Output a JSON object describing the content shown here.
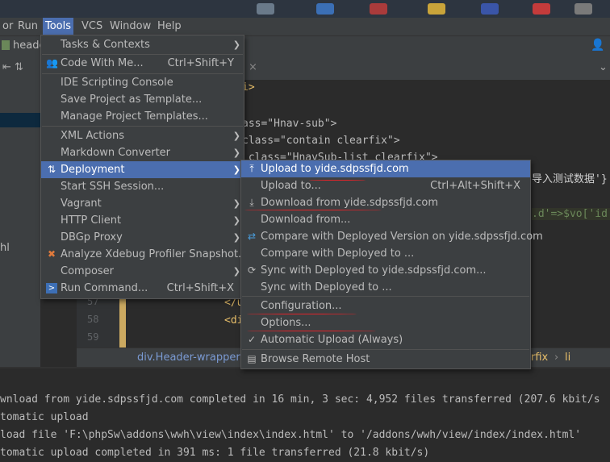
{
  "menubar": {
    "items": [
      {
        "label": "or"
      },
      {
        "label": "Run"
      },
      {
        "label": "Tools"
      },
      {
        "label": "VCS"
      },
      {
        "label": "Window"
      },
      {
        "label": "Help"
      }
    ]
  },
  "toolbar": {
    "tab_label": "heade",
    "close_icon": "×"
  },
  "editor": {
    "lines": [
      {
        "text": "i>"
      },
      {
        "text": "ass=\"Hnav-sub\">"
      },
      {
        "text": "class=\"contain clearfix\">"
      },
      {
        "text": " class=\"HnavSub-list clearfix\">"
      },
      {
        "text": "导入测试数据'}"
      },
      {
        "text": ".d'=>$vo['id'"
      }
    ],
    "line_numbers": [
      "57",
      "58",
      "59"
    ],
    "bottom_code": [
      {
        "text": "</u"
      },
      {
        "text": "<di"
      }
    ]
  },
  "breadcrumb": {
    "left": "div.Header-wrapper",
    "right_a": "rfix",
    "right_sep": "›",
    "right_b": "li"
  },
  "sidebar": {
    "label": "hl"
  },
  "console": {
    "lines": [
      "wnload from yide.sdpssfjd.com completed in 16 min, 3 sec: 4,952 files transferred (207.6 kbit/s",
      "tomatic upload",
      "load file 'F:\\phpSw\\addons\\wwh\\view\\index\\index.html' to '/addons/wwh/view/index/index.html'",
      "tomatic upload completed in 391 ms: 1 file transferred (21.8 kbit/s)"
    ]
  },
  "tools_menu": {
    "items": [
      {
        "label": "Tasks & Contexts",
        "shortcut": "",
        "submenu": true
      },
      {
        "label": "Code With Me...",
        "shortcut": "Ctrl+Shift+Y",
        "submenu": false
      },
      {
        "label": "IDE Scripting Console",
        "shortcut": "",
        "submenu": false
      },
      {
        "label": "Save Project as Template...",
        "shortcut": "",
        "submenu": false
      },
      {
        "label": "Manage Project Templates...",
        "shortcut": "",
        "submenu": false
      },
      {
        "label": "XML Actions",
        "shortcut": "",
        "submenu": true
      },
      {
        "label": "Markdown Converter",
        "shortcut": "",
        "submenu": true
      },
      {
        "label": "Deployment",
        "shortcut": "",
        "submenu": true
      },
      {
        "label": "Start SSH Session...",
        "shortcut": "",
        "submenu": false
      },
      {
        "label": "Vagrant",
        "shortcut": "",
        "submenu": true
      },
      {
        "label": "HTTP Client",
        "shortcut": "",
        "submenu": true
      },
      {
        "label": "DBGp Proxy",
        "shortcut": "",
        "submenu": true
      },
      {
        "label": "Analyze Xdebug Profiler Snapshot...",
        "shortcut": "",
        "submenu": false
      },
      {
        "label": "Composer",
        "shortcut": "",
        "submenu": true
      },
      {
        "label": "Run Command...",
        "shortcut": "Ctrl+Shift+X",
        "submenu": false
      }
    ]
  },
  "deployment_menu": {
    "items": [
      {
        "label": "Upload to yide.sdpssfjd.com",
        "shortcut": ""
      },
      {
        "label": "Upload to...",
        "shortcut": "Ctrl+Alt+Shift+X"
      },
      {
        "label": "Download from yide.sdpssfjd.com",
        "shortcut": ""
      },
      {
        "label": "Download from...",
        "shortcut": ""
      },
      {
        "label": "Compare with Deployed Version on yide.sdpssfjd.com",
        "shortcut": ""
      },
      {
        "label": "Compare with Deployed to ...",
        "shortcut": ""
      },
      {
        "label": "Sync with Deployed to yide.sdpssfjd.com...",
        "shortcut": ""
      },
      {
        "label": "Sync with Deployed to ...",
        "shortcut": ""
      },
      {
        "label": "Configuration...",
        "shortcut": ""
      },
      {
        "label": "Options...",
        "shortcut": ""
      },
      {
        "label": "Automatic Upload (Always)",
        "shortcut": ""
      },
      {
        "label": "Browse Remote Host",
        "shortcut": ""
      }
    ]
  },
  "colors": {
    "highlight": "#4b6eaf",
    "menu_bg": "#3c3f41",
    "annotation_red": "#e0242a"
  }
}
